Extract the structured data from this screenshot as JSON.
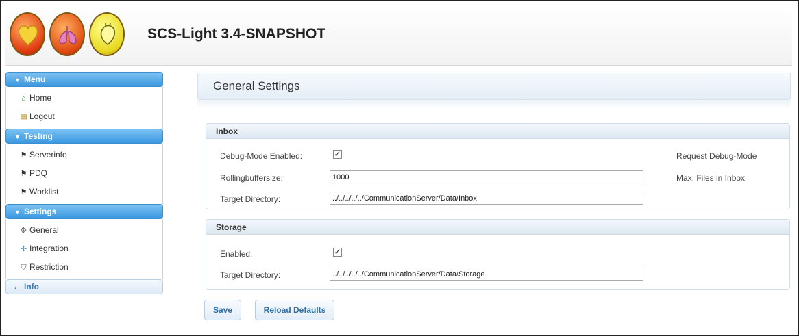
{
  "app": {
    "title": "SCS-Light 3.4-SNAPSHOT"
  },
  "header": {
    "logos": [
      "heart-logo-icon",
      "lungs-logo-icon",
      "heart-anatomy-logo-icon"
    ]
  },
  "sidebar": {
    "sections": [
      {
        "label": "Menu",
        "expanded": true,
        "items": [
          {
            "label": "Home",
            "icon": "home-icon"
          },
          {
            "label": "Logout",
            "icon": "logout-icon"
          }
        ]
      },
      {
        "label": "Testing",
        "expanded": true,
        "items": [
          {
            "label": "Serverinfo",
            "icon": "flag-icon"
          },
          {
            "label": "PDQ",
            "icon": "flag-icon"
          },
          {
            "label": "Worklist",
            "icon": "flag-icon"
          }
        ]
      },
      {
        "label": "Settings",
        "expanded": true,
        "items": [
          {
            "label": "General",
            "icon": "gear-icon"
          },
          {
            "label": "Integration",
            "icon": "integration-icon"
          },
          {
            "label": "Restriction",
            "icon": "shield-icon"
          }
        ]
      },
      {
        "label": "Info",
        "expanded": false,
        "items": []
      }
    ]
  },
  "main": {
    "title": "General Settings",
    "inbox": {
      "heading": "Inbox",
      "debug_label": "Debug-Mode Enabled:",
      "debug_checked": true,
      "debug_hint": "Request Debug-Mode",
      "buffer_label": "Rollingbuffersize:",
      "buffer_value": "1000",
      "buffer_hint": "Max. Files in Inbox",
      "target_label": "Target Directory:",
      "target_value": "../../../../../CommunicationServer/Data/Inbox"
    },
    "storage": {
      "heading": "Storage",
      "enabled_label": "Enabled:",
      "enabled_checked": true,
      "target_label": "Target Directory:",
      "target_value": "../../../../../CommunicationServer/Data/Storage"
    }
  },
  "buttons": {
    "save": "Save",
    "reload": "Reload Defaults"
  },
  "colors": {
    "accent": "#3a98e0",
    "link": "#2f6fa8"
  }
}
